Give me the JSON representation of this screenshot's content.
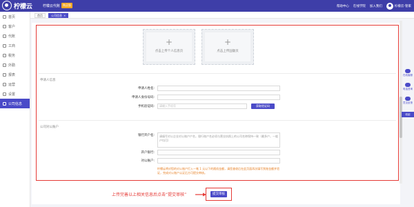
{
  "app": {
    "logo_text": "柠檬云",
    "company": "柠檬云代账",
    "company_badge": "购买版"
  },
  "topbar_right": {
    "links": [
      "帮助中心",
      "在线学院",
      "加入我们"
    ],
    "user": "柠檬云-管家"
  },
  "sidebar": {
    "items": [
      {
        "label": "首页",
        "icon": "home-icon",
        "active": false
      },
      {
        "label": "客户",
        "icon": "user-icon",
        "active": false
      },
      {
        "label": "代账",
        "icon": "ledger-icon",
        "active": false
      },
      {
        "label": "工商",
        "icon": "shield-icon",
        "active": false
      },
      {
        "label": "税务",
        "icon": "tax-icon",
        "active": false
      },
      {
        "label": "外勤",
        "icon": "field-icon",
        "active": false
      },
      {
        "label": "报表",
        "icon": "report-icon",
        "active": false
      },
      {
        "label": "运营",
        "icon": "chart-icon",
        "active": false
      },
      {
        "label": "设置",
        "icon": "gear-icon",
        "active": false
      },
      {
        "label": "公司信息",
        "icon": "company-icon",
        "active": true
      }
    ]
  },
  "tabs": [
    {
      "label": "首页",
      "active": false
    },
    {
      "label": "公司信息",
      "active": true,
      "close": "×"
    }
  ],
  "uploads": [
    {
      "plus": "+",
      "label": "点击上传个人信息页"
    },
    {
      "plus": "+",
      "label": "点击上传国徽页"
    }
  ],
  "applicant": {
    "section_title": "申请人信息",
    "name_label": "申请人姓名:",
    "id_label": "申请人身份号码:",
    "phone_label": "手机验证码:",
    "phone_placeholder": "请输入手机号",
    "code_button": "获取验证码"
  },
  "bank": {
    "section_title": "公司对公账户",
    "bank_name_label": "银行开户名:",
    "bank_name_hint": "请填写对公企业对公账户户名，银行账户名必须与营业执照上的公司名称保持一致（最多户，一般户均可）",
    "branch_label": "开户银行:",
    "account_label": "对公账户:",
    "warning": "柠檬云将对您的对公账户打入一笔 1 元以下的随机金额，请您查收后在此页面再次填写到账金额并验证，完成对公账户认证后方可提交审核。"
  },
  "annotation": {
    "text": "上传完善以上相关信息后点击“提交审核”"
  },
  "submit": {
    "label": "提交审核"
  },
  "float_panel": {
    "items": [
      {
        "label": "在线客服",
        "icon": "headset-icon"
      },
      {
        "label": "电话咨询",
        "icon": "phone-icon"
      },
      {
        "label": "意见反馈",
        "icon": "chat-icon"
      }
    ],
    "collapse_label": "收起"
  },
  "colors": {
    "primary": "#4b4bc8",
    "topbar": "#3e3ea8",
    "highlight": "#e53935",
    "warning": "#e67e22"
  }
}
